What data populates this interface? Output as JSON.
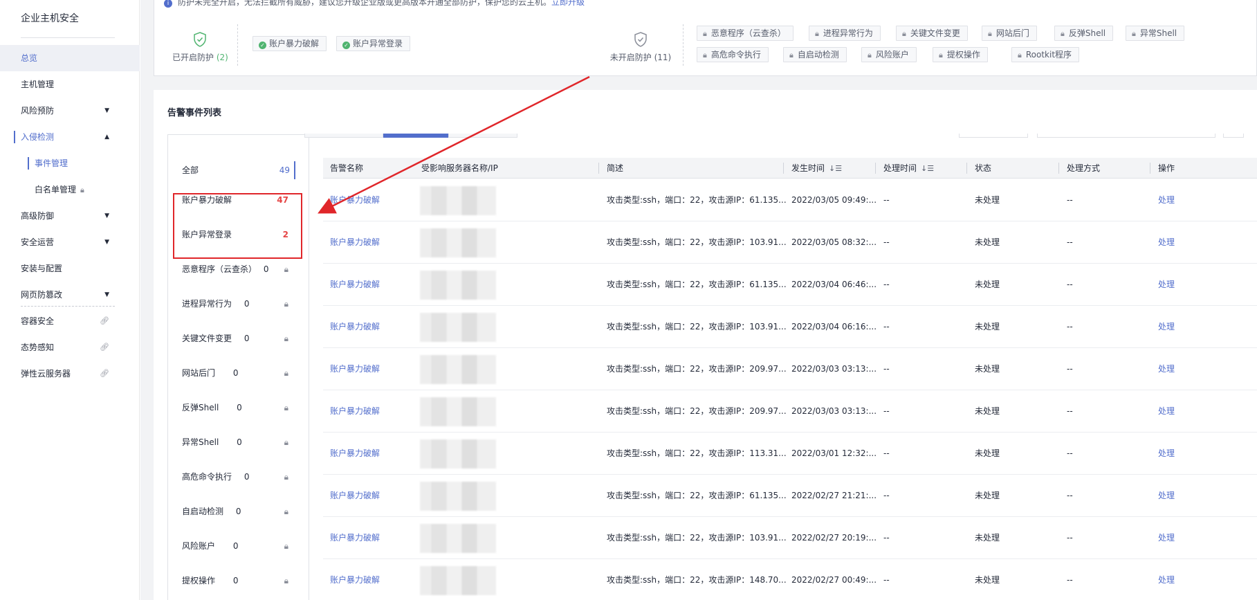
{
  "sidebar": {
    "title": "企业主机安全",
    "items": [
      {
        "label": "总览"
      },
      {
        "label": "主机管理"
      },
      {
        "label": "风险预防"
      },
      {
        "label": "入侵检测"
      },
      {
        "label": "事件管理"
      },
      {
        "label": "白名单管理"
      },
      {
        "label": "高级防御"
      },
      {
        "label": "安全运营"
      },
      {
        "label": "安装与配置"
      },
      {
        "label": "网页防篡改"
      },
      {
        "label": "容器安全"
      },
      {
        "label": "态势感知"
      },
      {
        "label": "弹性云服务器"
      }
    ]
  },
  "protection": {
    "notice": "防护未完全开启，无法拦截所有威胁，建议您升级企业版或更高版本开通全部防护，保护您的云主机。",
    "upgrade_link": "立即升级",
    "enabled_label": "已开启防护",
    "enabled_count": "(2)",
    "disabled_label": "未开启防护",
    "disabled_count": "(11)",
    "enabled_tags": [
      "账户暴力破解",
      "账户异常登录"
    ],
    "disabled_tags_row1": [
      "恶意程序（云查杀）",
      "进程异常行为",
      "关键文件变更",
      "网站后门",
      "反弹Shell",
      "异常Shell"
    ],
    "disabled_tags_row2": [
      "高危命令执行",
      "自启动检测",
      "风险账户",
      "提权操作",
      "Rootkit程序"
    ]
  },
  "alarm_list": {
    "title": "告警事件列表",
    "categories": [
      {
        "label": "全部",
        "count": "49"
      },
      {
        "label": "账户暴力破解",
        "count": "47"
      },
      {
        "label": "账户异常登录",
        "count": "2"
      },
      {
        "label": "恶意程序（云查杀）",
        "count": "0"
      },
      {
        "label": "进程异常行为",
        "count": "0"
      },
      {
        "label": "关键文件变更",
        "count": "0"
      },
      {
        "label": "网站后门",
        "count": "0"
      },
      {
        "label": "反弹Shell",
        "count": "0"
      },
      {
        "label": "异常Shell",
        "count": "0"
      },
      {
        "label": "高危命令执行",
        "count": "0"
      },
      {
        "label": "自启动检测",
        "count": "0"
      },
      {
        "label": "风险账户",
        "count": "0"
      },
      {
        "label": "提权操作",
        "count": "0"
      }
    ],
    "columns": [
      "告警名称",
      "受影响服务器名称/IP",
      "简述",
      "发生时间",
      "处理时间",
      "状态",
      "处理方式",
      "操作"
    ],
    "rows": [
      {
        "name": "账户暴力破解",
        "desc": "攻击类型:ssh，端口：22，攻击源IP：61.135...",
        "time": "2022/03/05 09:49:...",
        "handle_time": "--",
        "status": "未处理",
        "method": "--",
        "action": "处理"
      },
      {
        "name": "账户暴力破解",
        "desc": "攻击类型:ssh，端口：22，攻击源IP：103.91...",
        "time": "2022/03/05 08:32:...",
        "handle_time": "--",
        "status": "未处理",
        "method": "--",
        "action": "处理"
      },
      {
        "name": "账户暴力破解",
        "desc": "攻击类型:ssh，端口：22，攻击源IP：61.135...",
        "time": "2022/03/04 06:46:...",
        "handle_time": "--",
        "status": "未处理",
        "method": "--",
        "action": "处理"
      },
      {
        "name": "账户暴力破解",
        "desc": "攻击类型:ssh，端口：22，攻击源IP：103.91...",
        "time": "2022/03/04 06:16:...",
        "handle_time": "--",
        "status": "未处理",
        "method": "--",
        "action": "处理"
      },
      {
        "name": "账户暴力破解",
        "desc": "攻击类型:ssh，端口：22，攻击源IP：209.97...",
        "time": "2022/03/03 03:13:...",
        "handle_time": "--",
        "status": "未处理",
        "method": "--",
        "action": "处理"
      },
      {
        "name": "账户暴力破解",
        "desc": "攻击类型:ssh，端口：22，攻击源IP：209.97...",
        "time": "2022/03/03 03:13:...",
        "handle_time": "--",
        "status": "未处理",
        "method": "--",
        "action": "处理"
      },
      {
        "name": "账户暴力破解",
        "desc": "攻击类型:ssh，端口：22，攻击源IP：113.31...",
        "time": "2022/03/01 12:32:...",
        "handle_time": "--",
        "status": "未处理",
        "method": "--",
        "action": "处理"
      },
      {
        "name": "账户暴力破解",
        "desc": "攻击类型:ssh，端口：22，攻击源IP：61.135...",
        "time": "2022/02/27 21:21:...",
        "handle_time": "--",
        "status": "未处理",
        "method": "--",
        "action": "处理"
      },
      {
        "name": "账户暴力破解",
        "desc": "攻击类型:ssh，端口：22，攻击源IP：103.91...",
        "time": "2022/02/27 20:19:...",
        "handle_time": "--",
        "status": "未处理",
        "method": "--",
        "action": "处理"
      },
      {
        "name": "账户暴力破解",
        "desc": "攻击类型:ssh，端口：22，攻击源IP：148.70...",
        "time": "2022/02/27 00:49:...",
        "handle_time": "--",
        "status": "未处理",
        "method": "--",
        "action": "处理"
      }
    ]
  },
  "colors": {
    "accent": "#526ecc",
    "danger": "#e54545",
    "annotation": "#e0262a",
    "success": "#50b470"
  }
}
